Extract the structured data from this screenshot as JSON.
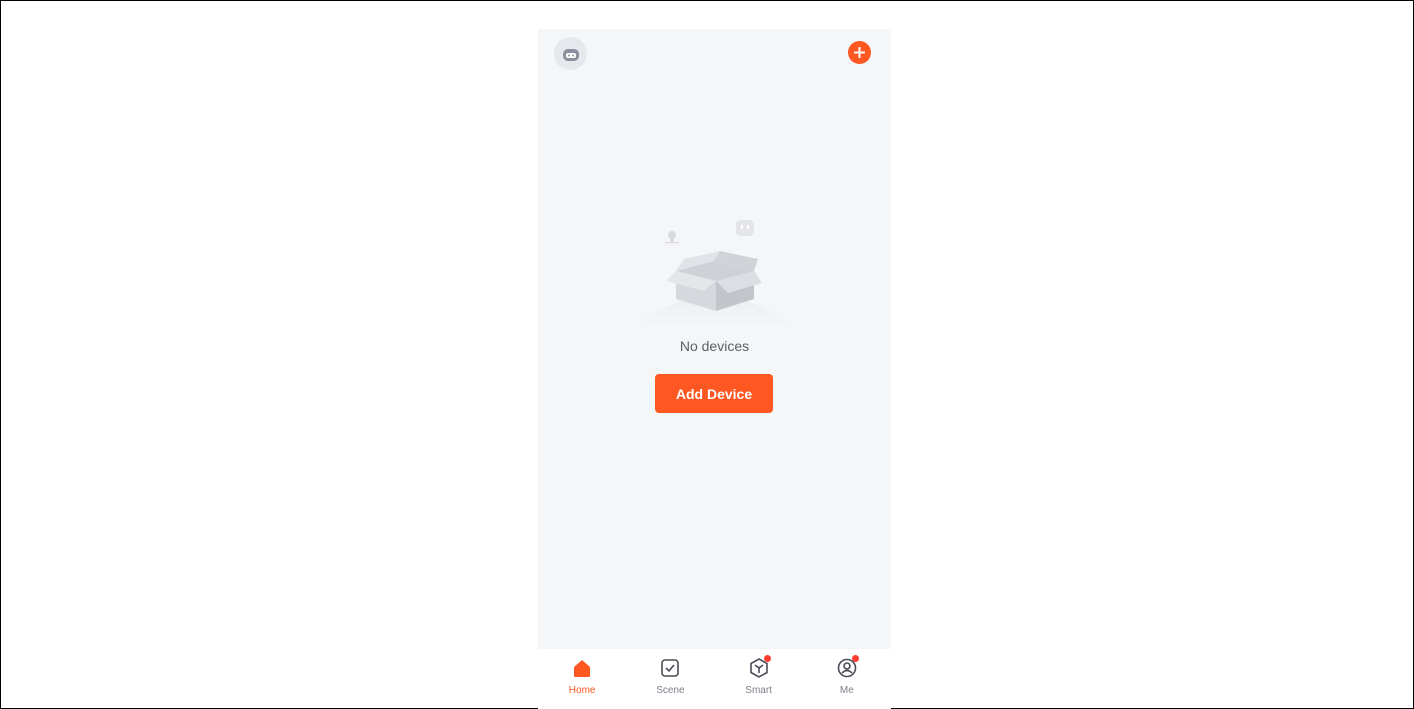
{
  "header": {
    "avatar_icon": "robot-avatar-icon",
    "add_icon": "plus-icon",
    "accent_color": "#ff5722"
  },
  "empty_state": {
    "message": "No devices",
    "button_label": "Add Device",
    "illustration": "empty-box-icon"
  },
  "tabbar": {
    "tabs": [
      {
        "label": "Home",
        "icon": "home-icon",
        "active": true,
        "badge": false
      },
      {
        "label": "Scene",
        "icon": "scene-checkbox-icon",
        "active": false,
        "badge": false
      },
      {
        "label": "Smart",
        "icon": "smart-cube-icon",
        "active": false,
        "badge": true
      },
      {
        "label": "Me",
        "icon": "profile-icon",
        "active": false,
        "badge": true
      }
    ]
  }
}
